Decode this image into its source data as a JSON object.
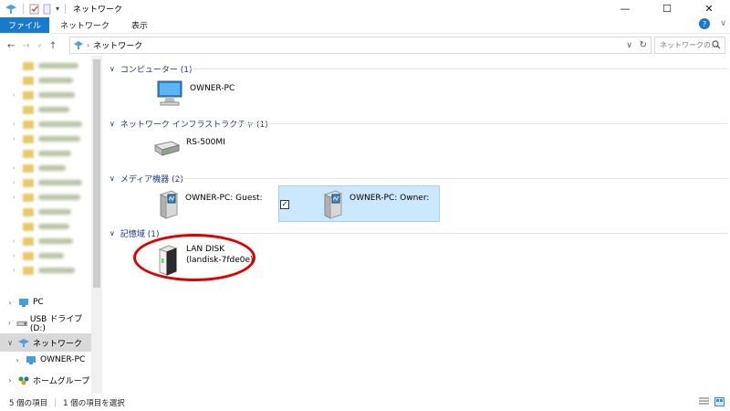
{
  "window": {
    "title": "ネットワーク",
    "minimize": "—",
    "maximize": "☐",
    "close": "✕"
  },
  "ribbon": {
    "tabs": [
      {
        "label": "ファイル",
        "active": true
      },
      {
        "label": "ネットワーク"
      },
      {
        "label": "表示"
      }
    ],
    "help": "?",
    "collapse": "∨"
  },
  "address": {
    "crumb": "ネットワーク",
    "search_placeholder": "ネットワークの..."
  },
  "tree": {
    "pc": "PC",
    "usb": "USB ドライブ (D:)",
    "network": "ネットワーク",
    "owner_pc": "OWNER-PC",
    "homegroup": "ホームグループ"
  },
  "groups": [
    {
      "label": "コンピューター (1)"
    },
    {
      "label": "ネットワーク インフラストラクチャ (1)"
    },
    {
      "label": "メディア機器 (2)"
    },
    {
      "label": "記憶域 (1)"
    }
  ],
  "items": {
    "owner_pc": "OWNER-PC",
    "router": "RS-500MI",
    "media_guest": "OWNER-PC: Guest:",
    "media_owner": "OWNER-PC: Owner:",
    "landisk_name": "LAN DISK",
    "landisk_id": "(landisk-7fde0e)"
  },
  "status": {
    "count": "5 個の項目",
    "selected": "1 個の項目を選択"
  },
  "colors": {
    "accent": "#1979ca",
    "selection": "#cce8ff",
    "highlight": "#e00000"
  }
}
